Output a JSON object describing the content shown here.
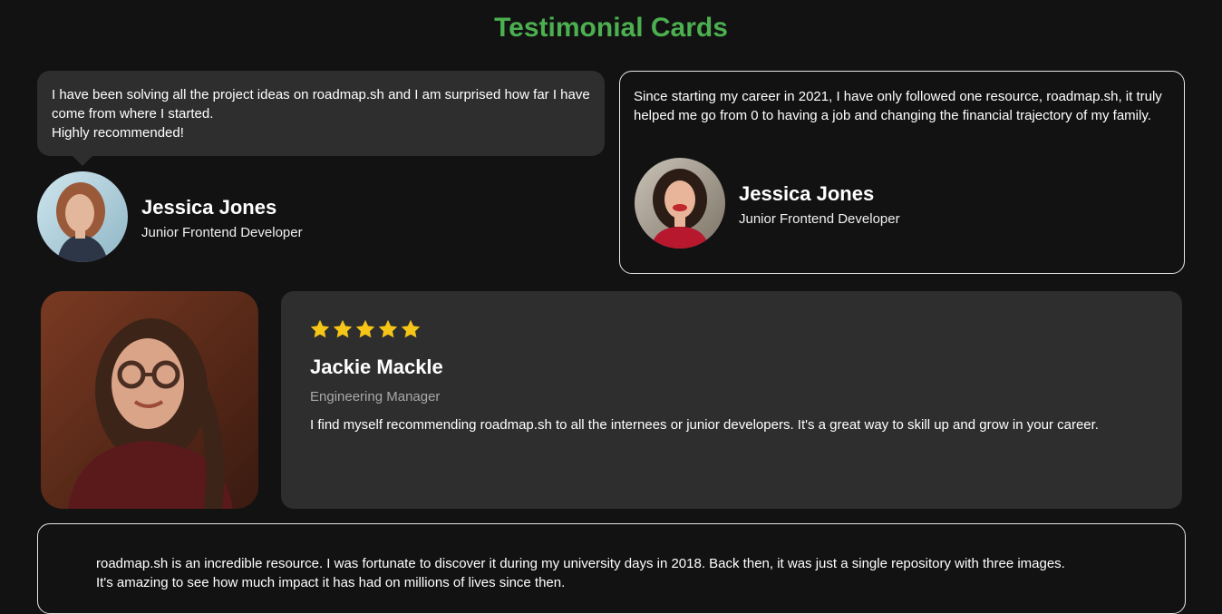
{
  "page": {
    "title": "Testimonial Cards",
    "accent_color": "#4caf50"
  },
  "card1": {
    "quote_lines": [
      "I have been solving all the project ideas on roadmap.sh and I am surprised how far I have come from where I started.",
      "Highly recommended!"
    ],
    "name": "Jessica Jones",
    "role": "Junior Frontend Developer",
    "avatar_icon": "user-photo-redhead"
  },
  "card2": {
    "quote": "Since starting my career in 2021, I have only followed one resource, roadmap.sh, it truly helped me go from 0 to having a job and changing the financial trajectory of my family.",
    "name": "Jessica Jones",
    "role": "Junior Frontend Developer",
    "avatar_icon": "user-photo-smiling"
  },
  "card3": {
    "rating": 5,
    "star_color": "#f5c518",
    "name": "Jackie Mackle",
    "role": "Engineering Manager",
    "quote": "I find myself recommending roadmap.sh to all the internees or junior developers. It's a great way to skill up and grow in your career.",
    "photo_icon": "user-photo-glasses"
  },
  "card4": {
    "quote_lines": [
      "roadmap.sh is an incredible resource. I was fortunate to discover it during my university days in 2018. Back then, it was just a single repository with three images.",
      "It's amazing to see how much impact it has had on millions of lives since then."
    ]
  }
}
